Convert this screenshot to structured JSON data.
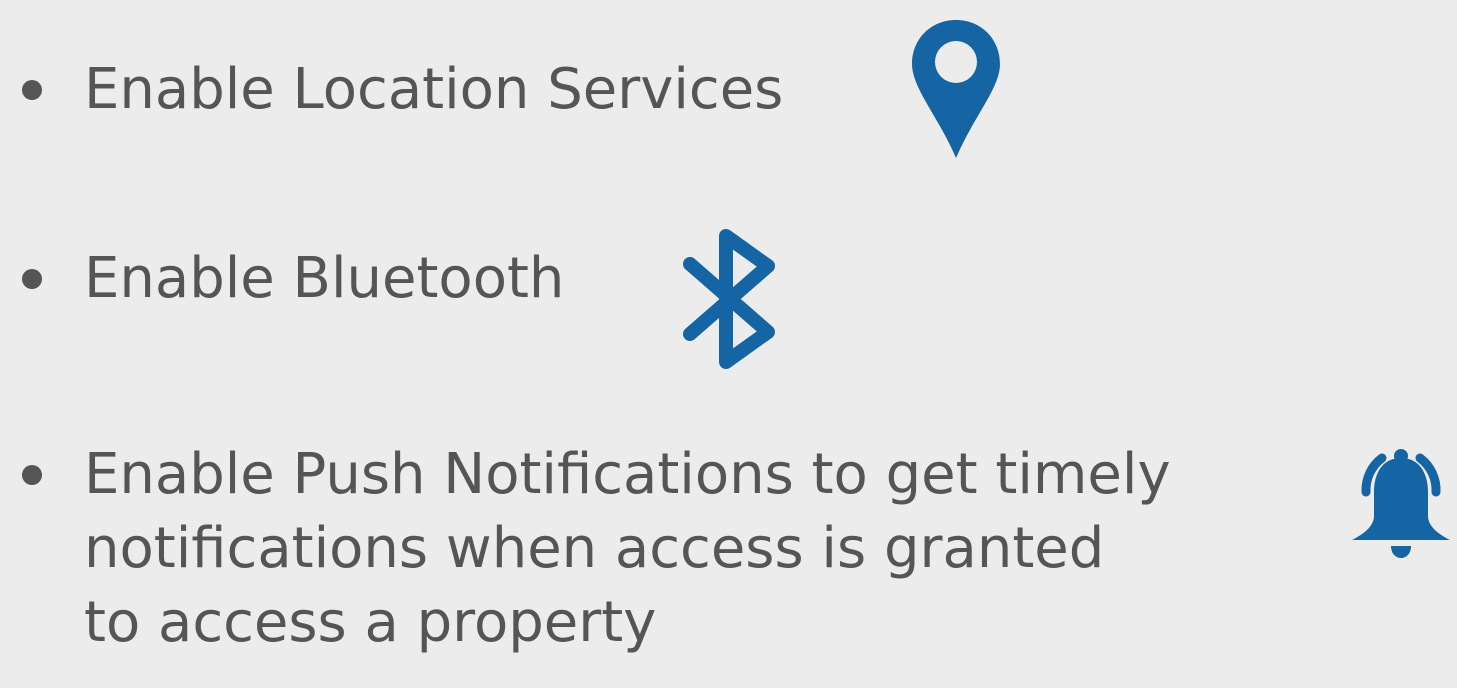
{
  "colors": {
    "background": "#ececec",
    "text": "#555555",
    "icon_accent": "#1565a5"
  },
  "items": [
    {
      "text": "Enable Location Services",
      "icon": "location-pin-icon"
    },
    {
      "text": "Enable Bluetooth",
      "icon": "bluetooth-icon"
    },
    {
      "lines": [
        "Enable Push Notifications to get timely",
        "notifications when access is granted",
        "to access a property"
      ],
      "icon": "bell-ringing-icon"
    }
  ]
}
